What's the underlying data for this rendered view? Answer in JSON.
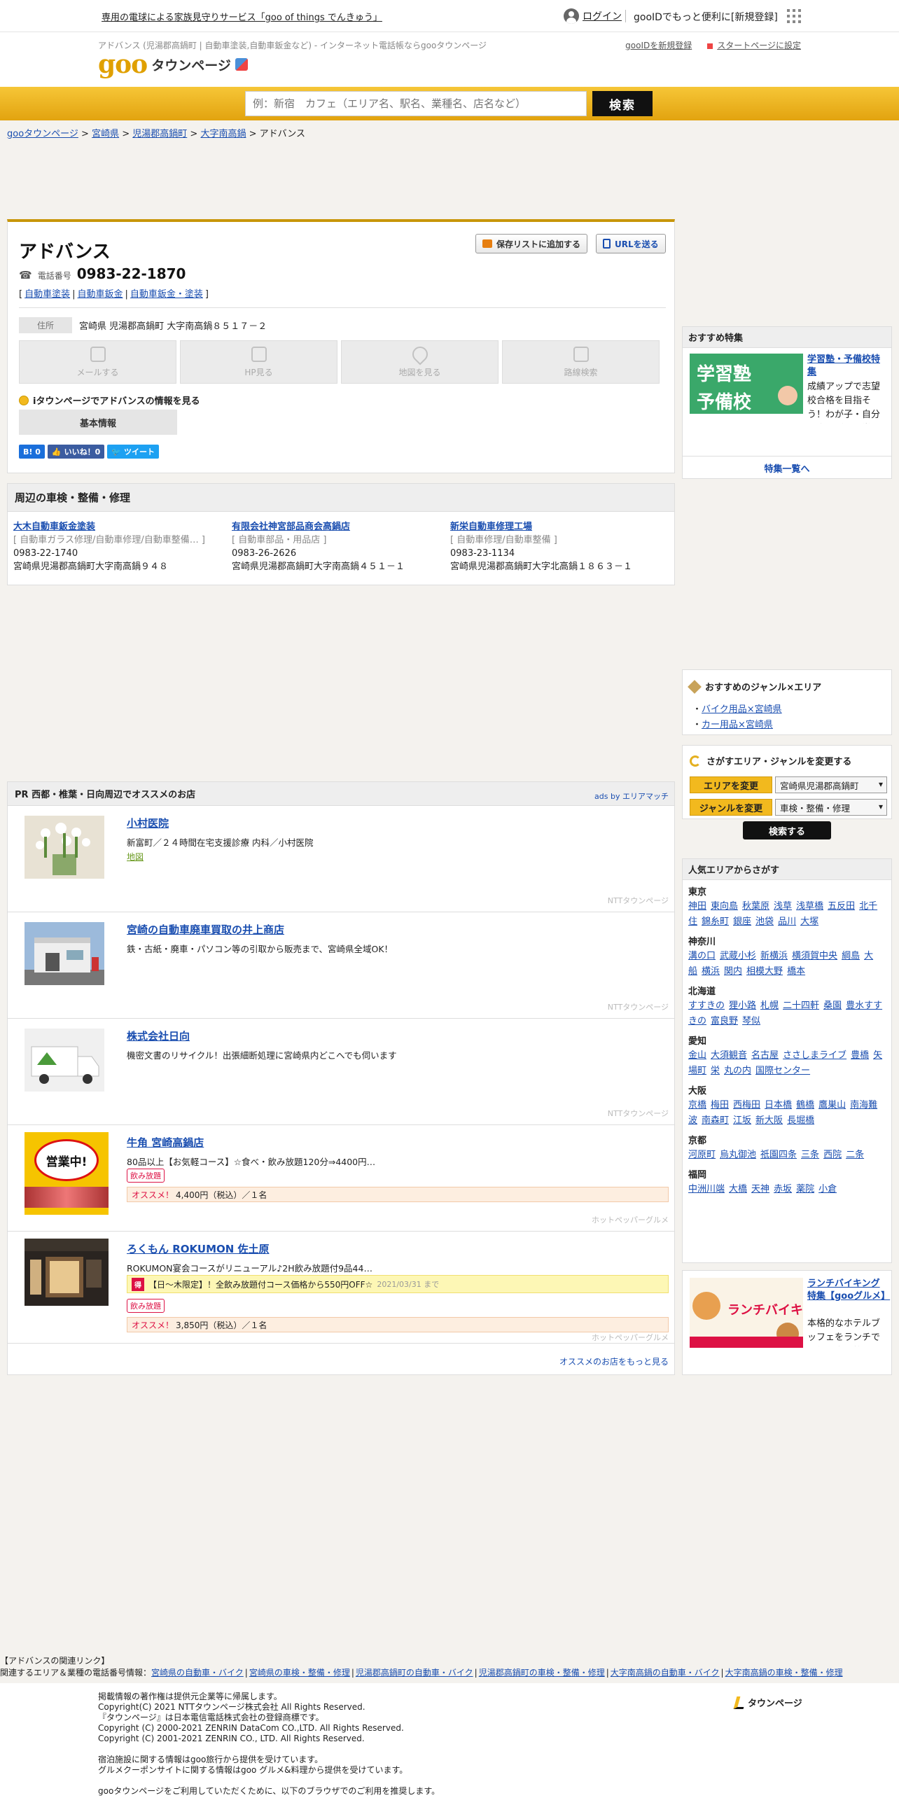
{
  "topbar": {
    "promo": "専用の電球による家族見守りサービス「goo of things でんきゅう」",
    "login": "ログイン",
    "register": "gooIDでもっと便利に[新規登録]"
  },
  "header": {
    "subtitle": "アドバンス (児湯郡高鍋町 | 自動車塗装,自動車鈑金など) - インターネット電話帳ならgooタウンページ",
    "logo_goo": "goo",
    "logo_tp": "タウンページ",
    "link_newid": "gooIDを新規登録",
    "link_start": "スタートページに設定"
  },
  "search": {
    "placeholder": "例：新宿　カフェ（エリア名、駅名、業種名、店名など）",
    "button": "検索"
  },
  "breadcrumb": {
    "items": [
      "gooタウンページ",
      "宮崎県",
      "児湯郡高鍋町",
      "大字南高鍋"
    ],
    "current": "アドバンス",
    "sep": " > "
  },
  "business": {
    "name": "アドバンス",
    "save_btn": "保存リストに追加する",
    "url_btn": "URLを送る",
    "tel_label": "電話番号",
    "tel": "0983-22-1870",
    "categories": [
      "自動車塗装",
      "自動車鈑金",
      "自動車鈑金・塗装"
    ],
    "addr_label": "住所",
    "address": "宮崎県 児湯郡高鍋町 大字南高鍋８５１７－２",
    "actions": [
      "メールする",
      "HP見る",
      "地図を見る",
      "路線検索"
    ],
    "itown": "iタウンページでアドバンスの情報を見る",
    "basic_tab": "基本情報",
    "social": {
      "hatena": "B! 0",
      "fb": "いいね！0",
      "tw": "ツイート"
    }
  },
  "nearby": {
    "heading": "周辺の車検・整備・修理",
    "items": [
      {
        "name": "大木自動車鈑金塗装",
        "cat": "[ 自動車ガラス修理/自動車修理/自動車整備… ]",
        "tel": "0983-22-1740",
        "addr": "宮崎県児湯郡高鍋町大字南高鍋９４８"
      },
      {
        "name": "有限会社神宮部品商会高鍋店",
        "cat": "[ 自動車部品・用品店 ]",
        "tel": "0983-26-2626",
        "addr": "宮崎県児湯郡高鍋町大字南高鍋４５１－１"
      },
      {
        "name": "新栄自動車修理工場",
        "cat": "[ 自動車修理/自動車整備 ]",
        "tel": "0983-23-1134",
        "addr": "宮崎県児湯郡高鍋町大字北高鍋１８６３－１"
      }
    ]
  },
  "pr": {
    "heading": "PR  西都・椎葉・日向周辺でオススメのお店",
    "ads": "ads by エリアマッチ",
    "items": [
      {
        "title": "小村医院",
        "desc": "新富町／２４時間在宅支援診療 内科／小村医院",
        "link": "地図",
        "src": "NTTタウンページ"
      },
      {
        "title": "宮崎の自動車廃車買取の井上商店",
        "desc": "鉄・古紙・廃車・パソコン等の引取から販売まで、宮崎県全域OK！",
        "src": "NTTタウンページ"
      },
      {
        "title": "株式会社日向",
        "desc": "機密文書のリサイクル！出張細断処理に宮崎県内どこへでも伺います",
        "src": "NTTタウンページ"
      },
      {
        "title": "牛角 宮崎高鍋店",
        "desc": "80品以上【お気軽コース】☆食べ・飲み放題120分⇒4400円…",
        "tag": "飲み放題",
        "price_label": "オススメ！",
        "price": "4,400円（税込）／１名",
        "src": "ホットペッパーグルメ",
        "thumb_text": "営業中!"
      },
      {
        "title": "ろくもん ROKUMON 佐土原",
        "desc": "ROKUMON宴会コースがリニューアル♪2H飲み放題付9品44…",
        "promo_badge": "得",
        "promo": "【日〜木限定】！全飲み放題付コース価格から550円OFF☆",
        "promo_date": "2021/03/31 まで",
        "tag": "飲み放題",
        "price_label": "オススメ！",
        "price": "3,850円（税込）／１名",
        "src": "ホットペッパーグルメ"
      }
    ],
    "more": "オススメのお店をもっと見る"
  },
  "side": {
    "feature_head": "おすすめ特集",
    "feature_title": "学習塾・予備校特集",
    "feature_desc": "成績アップで志望校合格を目指そう！わが子・自分に合う近くの学習塾・予備校をご紹介します。",
    "feature_list": "特集一覧へ",
    "genre_head": "おすすめのジャンル×エリア",
    "genre_items": [
      "バイク用品×宮崎県",
      "カー用品×宮崎県"
    ],
    "change_head": "さがすエリア・ジャンルを変更する",
    "area_btn": "エリアを変更",
    "area_val": "宮崎県児湯郡高鍋町",
    "genre_btn": "ジャンルを変更",
    "genre_val": "車検・整備・修理",
    "search_btn": "検索する",
    "popular_head": "人気エリアからさがす",
    "regions": [
      {
        "name": "東京",
        "areas": [
          "神田",
          "東向島",
          "秋葉原",
          "浅草",
          "浅草橋",
          "五反田",
          "北千住",
          "錦糸町",
          "銀座",
          "池袋",
          "品川",
          "大塚"
        ]
      },
      {
        "name": "神奈川",
        "areas": [
          "溝の口",
          "武蔵小杉",
          "新横浜",
          "横須賀中央",
          "綱島",
          "大船",
          "横浜",
          "関内",
          "相模大野",
          "橋本"
        ]
      },
      {
        "name": "北海道",
        "areas": [
          "すすきの",
          "狸小路",
          "札幌",
          "二十四軒",
          "桑園",
          "豊水すすきの",
          "富良野",
          "琴似"
        ]
      },
      {
        "name": "愛知",
        "areas": [
          "金山",
          "大須観音",
          "名古屋",
          "ささしまライブ",
          "豊橋",
          "矢場町",
          "栄",
          "丸の内",
          "国際センター"
        ]
      },
      {
        "name": "大阪",
        "areas": [
          "京橋",
          "梅田",
          "西梅田",
          "日本橋",
          "鶴橋",
          "鷹巣山",
          "南海難波",
          "南森町",
          "江坂",
          "新大阪",
          "長堀橋"
        ]
      },
      {
        "name": "京都",
        "areas": [
          "河原町",
          "烏丸御池",
          "祇園四条",
          "三条",
          "西院",
          "二条"
        ]
      },
      {
        "name": "福岡",
        "areas": [
          "中洲川端",
          "大橋",
          "天神",
          "赤坂",
          "薬院",
          "小倉"
        ]
      }
    ],
    "lunch_title": "ランチバイキング特集【gooグルメ】",
    "lunch_desc": "本格的なホテルブッフェをランチでお得に食べ放題！"
  },
  "footer": {
    "related_head": "【アドバンスの関連リンク】",
    "related_label": "関連するエリア＆業種の電話番号情報：",
    "related_links": [
      "宮崎県の自動車・バイク",
      "宮崎県の車検・整備・修理",
      "児湯郡高鍋町の自動車・バイク",
      "児湯郡高鍋町の車検・整備・修理",
      "大字南高鍋の自動車・バイク",
      "大字南高鍋の車検・整備・修理"
    ],
    "lines": [
      "掲載情報の著作権は提供元企業等に帰属します。",
      "Copyright(C) 2021 NTTタウンページ株式会社 All Rights Reserved.",
      "『タウンページ』は日本電信電話株式会社の登録商標です。",
      "Copyright (C) 2000-2021 ZENRIN DataCom CO.,LTD. All Rights Reserved.",
      "Copyright (C) 2001-2021 ZENRIN CO., LTD. All Rights Reserved.",
      "",
      "宿泊施設に関する情報はgoo旅行から提供を受けています。",
      "グルメクーポンサイトに関する情報はgoo グルメ&料理から提供を受けています。",
      "",
      "gooタウンページをご利用していただくために、以下のブラウザでのご利用を推奨します。"
    ],
    "tp_logo": "タウンページ"
  }
}
